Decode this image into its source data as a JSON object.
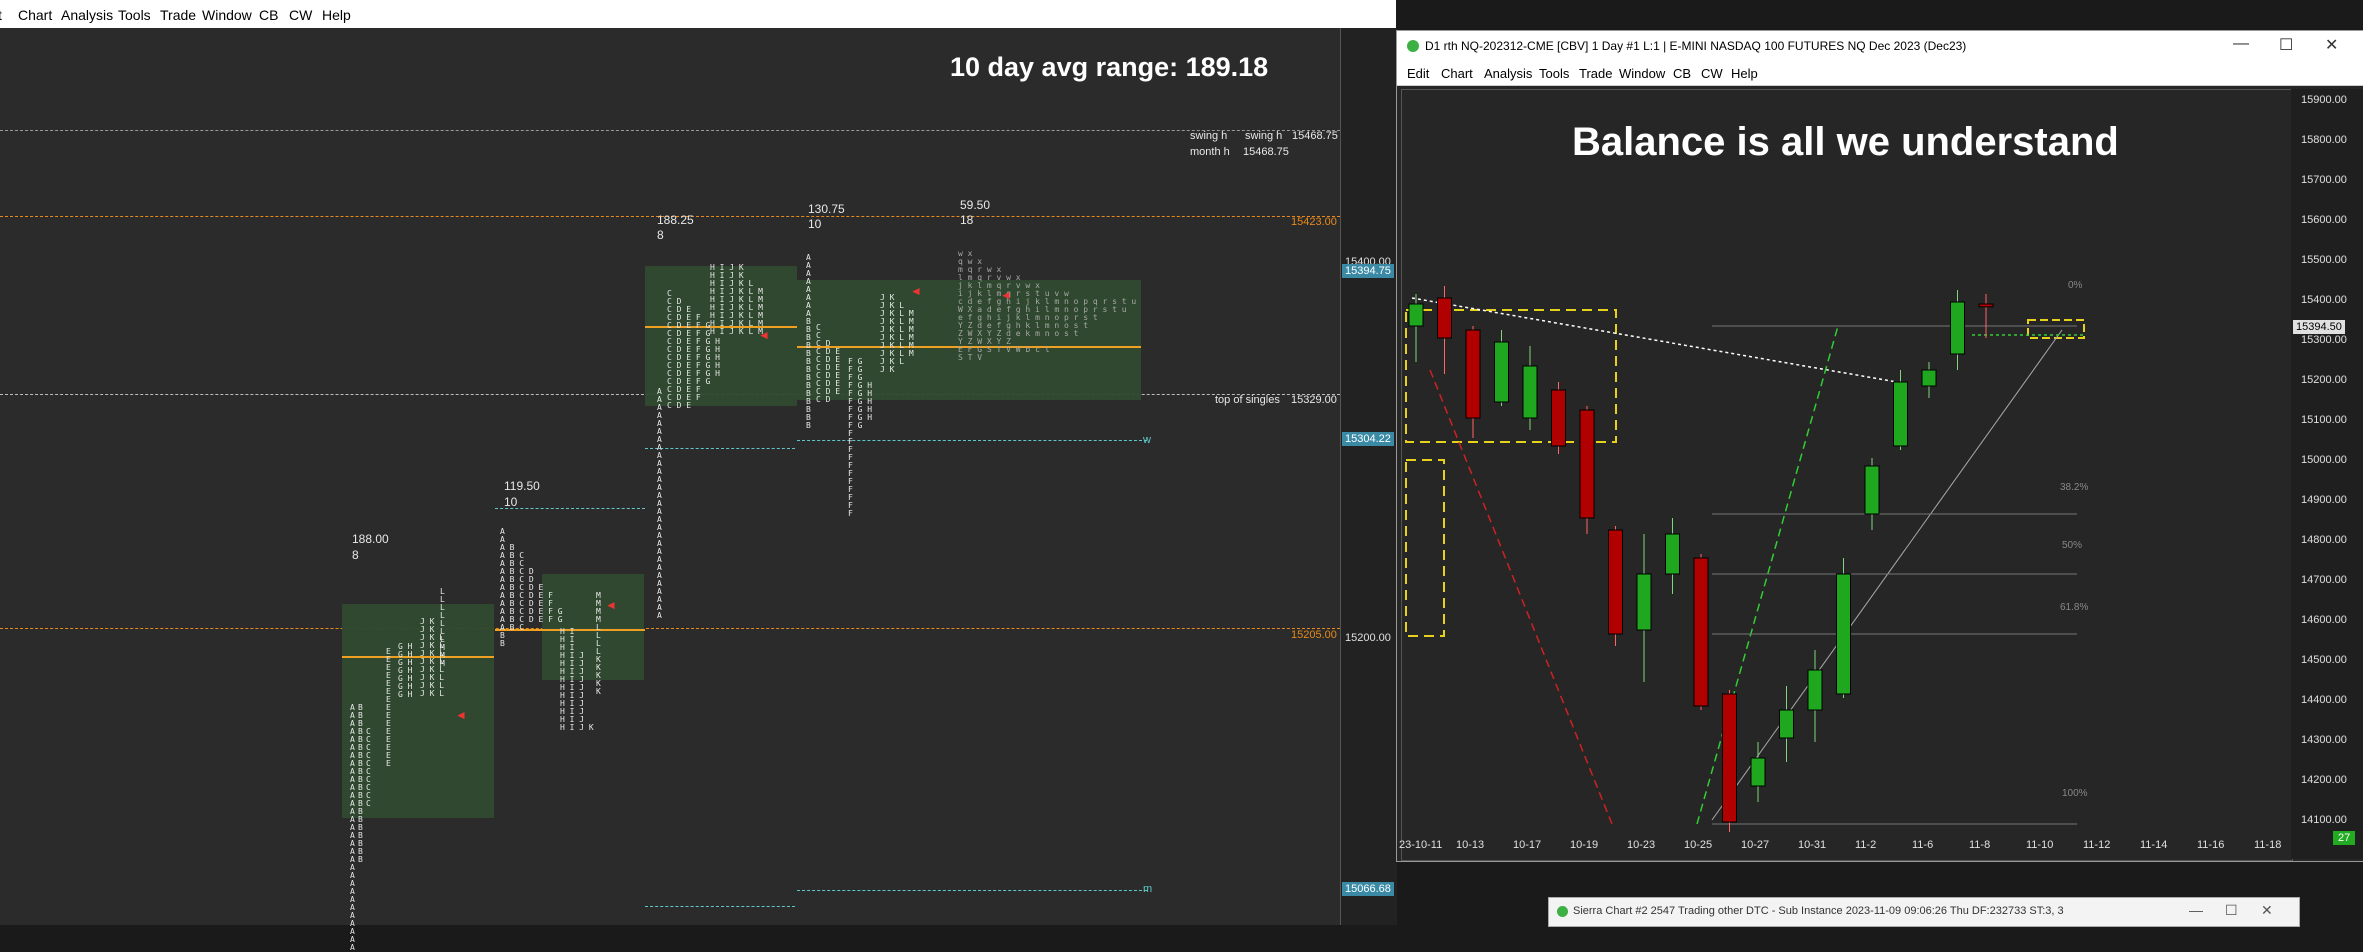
{
  "left_window": {
    "menu": [
      "t",
      "Chart",
      "Analysis",
      "Tools",
      "Trade",
      "Window",
      "CB",
      "CW",
      "Help"
    ],
    "title": "10 day avg range:  189.18",
    "labels": {
      "swing_h_a": "swing h",
      "swing_h_b": "swing h",
      "swing_h_val": "15468.75",
      "month_h": "month h",
      "month_h_val": "15468.75",
      "top_of_singles": "top of singles",
      "top_of_singles_val": "15329.00",
      "line_15423": "15423.00",
      "line_15205": "15205.00",
      "w_marker": "w",
      "m_marker": "m"
    },
    "session_stats": [
      {
        "range": "188.00",
        "count": "8"
      },
      {
        "range": "119.50",
        "count": "10"
      },
      {
        "range": "188.25",
        "count": "8"
      },
      {
        "range": "130.75",
        "count": "10"
      },
      {
        "range": "59.50",
        "count": "18"
      }
    ],
    "price_scale": {
      "p15400": "15400.00",
      "current": "15394.75",
      "p15304": "15304.22",
      "p15200": "15200.00",
      "p15066": "15066.68"
    },
    "colors": {
      "current": "#3a8aa5",
      "line_orange": "#e88a1a",
      "va_green": "#2f4a2f",
      "poc": "#f0a020"
    }
  },
  "right_window": {
    "title": "D1 rth NQ-202312-CME [CBV]  1 Day  #1 L:1 | E-MINI NASDAQ 100 FUTURES NQ Dec 2023 (Dec23)",
    "menu": [
      "Edit",
      "Chart",
      "Analysis",
      "Tools",
      "Trade",
      "Window",
      "CB",
      "CW",
      "Help"
    ],
    "headline": "Balance is all we understand",
    "fib_labels": {
      "f382": "38.2%",
      "f50": "50%",
      "f618": "61.8%",
      "f100": "100%",
      "f0": "0%"
    },
    "current_price": "15394.50",
    "corner_badge": "27",
    "y_ticks": [
      "15900.00",
      "15800.00",
      "15700.00",
      "15600.00",
      "15500.00",
      "15400.00",
      "15300.00",
      "15200.00",
      "15100.00",
      "15000.00",
      "14900.00",
      "14800.00",
      "14700.00",
      "14600.00",
      "14500.00",
      "14400.00",
      "14300.00",
      "14200.00",
      "14100.00"
    ],
    "x_ticks": [
      "23-10-11",
      "10-13",
      "10-17",
      "10-19",
      "10-23",
      "10-25",
      "10-27",
      "10-31",
      "11-2",
      "11-6",
      "11-8",
      "11-10",
      "11-12",
      "11-14",
      "11-16",
      "11-18"
    ],
    "candles": [
      {
        "o": 15340,
        "c": 15395,
        "h": 15420,
        "l": 15250
      },
      {
        "o": 15410,
        "c": 15310,
        "h": 15440,
        "l": 15220
      },
      {
        "o": 15330,
        "c": 15110,
        "h": 15340,
        "l": 15060
      },
      {
        "o": 15150,
        "c": 15300,
        "h": 15330,
        "l": 15140
      },
      {
        "o": 15110,
        "c": 15240,
        "h": 15290,
        "l": 15080
      },
      {
        "o": 15180,
        "c": 15040,
        "h": 15200,
        "l": 15020
      },
      {
        "o": 15130,
        "c": 14860,
        "h": 15140,
        "l": 14820
      },
      {
        "o": 14830,
        "c": 14570,
        "h": 14840,
        "l": 14540
      },
      {
        "o": 14580,
        "c": 14720,
        "h": 14820,
        "l": 14450
      },
      {
        "o": 14720,
        "c": 14820,
        "h": 14860,
        "l": 14670
      },
      {
        "o": 14760,
        "c": 14390,
        "h": 14770,
        "l": 14380
      },
      {
        "o": 14420,
        "c": 14100,
        "h": 14430,
        "l": 14050
      },
      {
        "o": 14190,
        "c": 14260,
        "h": 14300,
        "l": 14150
      },
      {
        "o": 14310,
        "c": 14380,
        "h": 14440,
        "l": 14250
      },
      {
        "o": 14380,
        "c": 14480,
        "h": 14530,
        "l": 14300
      },
      {
        "o": 14420,
        "c": 14720,
        "h": 14760,
        "l": 14410
      },
      {
        "o": 14870,
        "c": 14990,
        "h": 15010,
        "l": 14830
      },
      {
        "o": 15040,
        "c": 15200,
        "h": 15230,
        "l": 15030
      },
      {
        "o": 15190,
        "c": 15230,
        "h": 15250,
        "l": 15160
      },
      {
        "o": 15270,
        "c": 15400,
        "h": 15430,
        "l": 15230
      },
      {
        "o": 15395,
        "c": 15388,
        "h": 15420,
        "l": 15310
      }
    ]
  },
  "bottom_window": {
    "title": "Sierra Chart #2 2547 Trading other DTC - Sub Instance 2023-11-09  09:06:26 Thu  DF:232733  ST:3, 3"
  }
}
